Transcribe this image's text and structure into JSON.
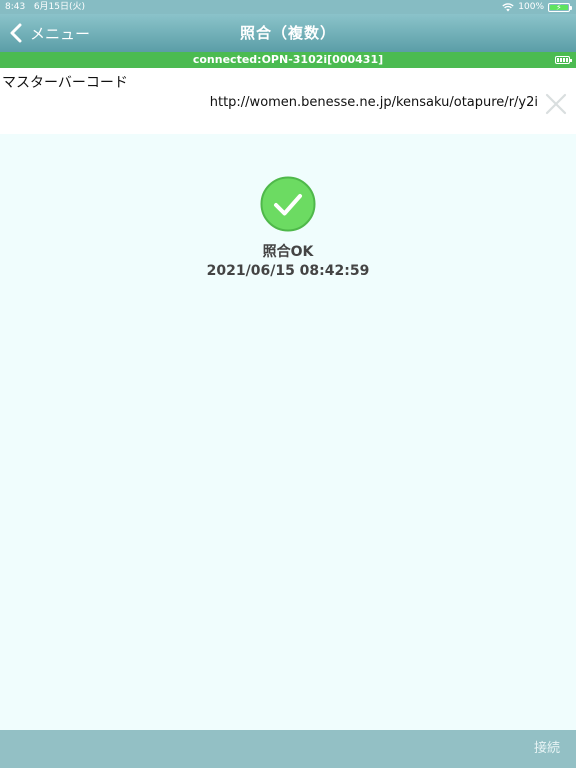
{
  "status_bar": {
    "time": "8:43",
    "date": "6月15日(火)",
    "battery_percent": "100%",
    "icons": [
      "wifi-icon",
      "battery-charging-icon"
    ]
  },
  "nav": {
    "back_label": "メニュー",
    "title": "照合（複数）"
  },
  "connection": {
    "text": "connected:OPN-3102i[000431]",
    "color": "#4bbb51"
  },
  "barcode": {
    "label": "マスターバーコード",
    "value": "http://women.benesse.ne.jp/kensaku/otapure/r/y2i"
  },
  "result": {
    "status": "照合OK",
    "timestamp": "2021/06/15 08:42:59",
    "color": "#6cdb62"
  },
  "toolbar": {
    "connect_label": "接続"
  }
}
